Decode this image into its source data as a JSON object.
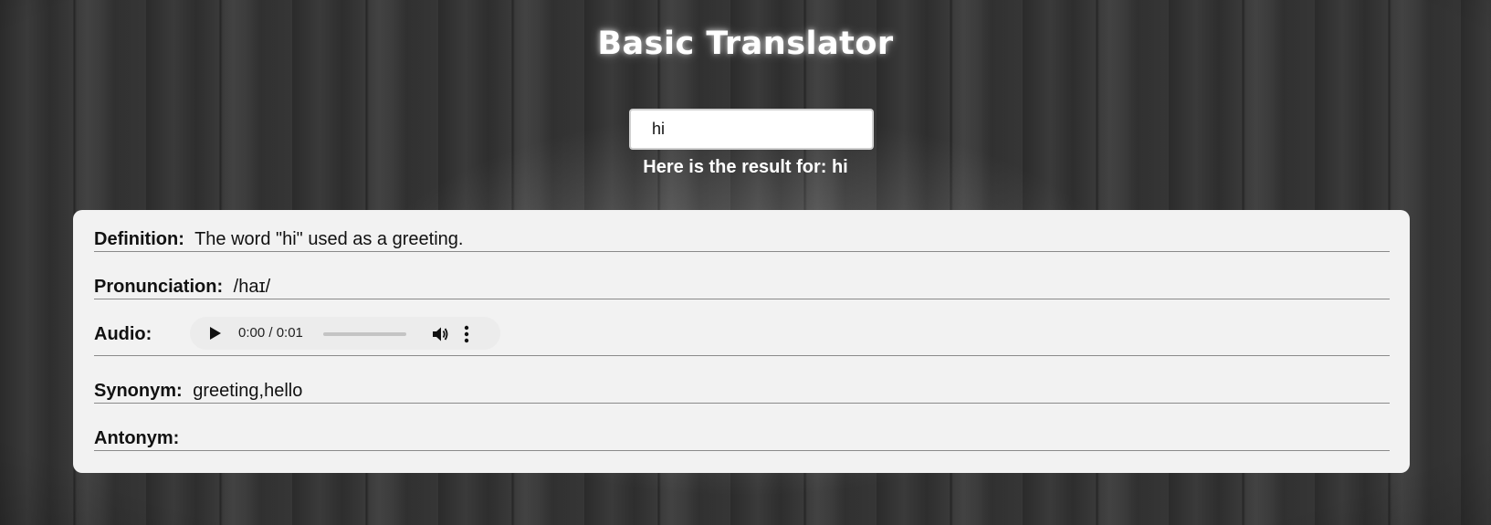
{
  "header": {
    "title": "Basic Translator"
  },
  "search": {
    "value": "hi"
  },
  "result": {
    "heading": "Here is the result for: hi",
    "definition_label": "Definition:",
    "definition_value": "The word \"hi\" used as a greeting.",
    "pronunciation_label": "Pronunciation:",
    "pronunciation_value": "/haɪ/",
    "audio_label": "Audio:",
    "audio": {
      "time": "0:00 / 0:01",
      "progress": 0,
      "icons": [
        "play-icon",
        "volume-icon",
        "more-icon"
      ]
    },
    "synonym_label": "Synonym:",
    "synonym_value": "greeting,hello",
    "antonym_label": "Antonym:",
    "antonym_value": ""
  },
  "colors": {
    "card_background": "#f2f2f2",
    "title_text": "#ffffff",
    "divider": "#8a8a8a"
  }
}
